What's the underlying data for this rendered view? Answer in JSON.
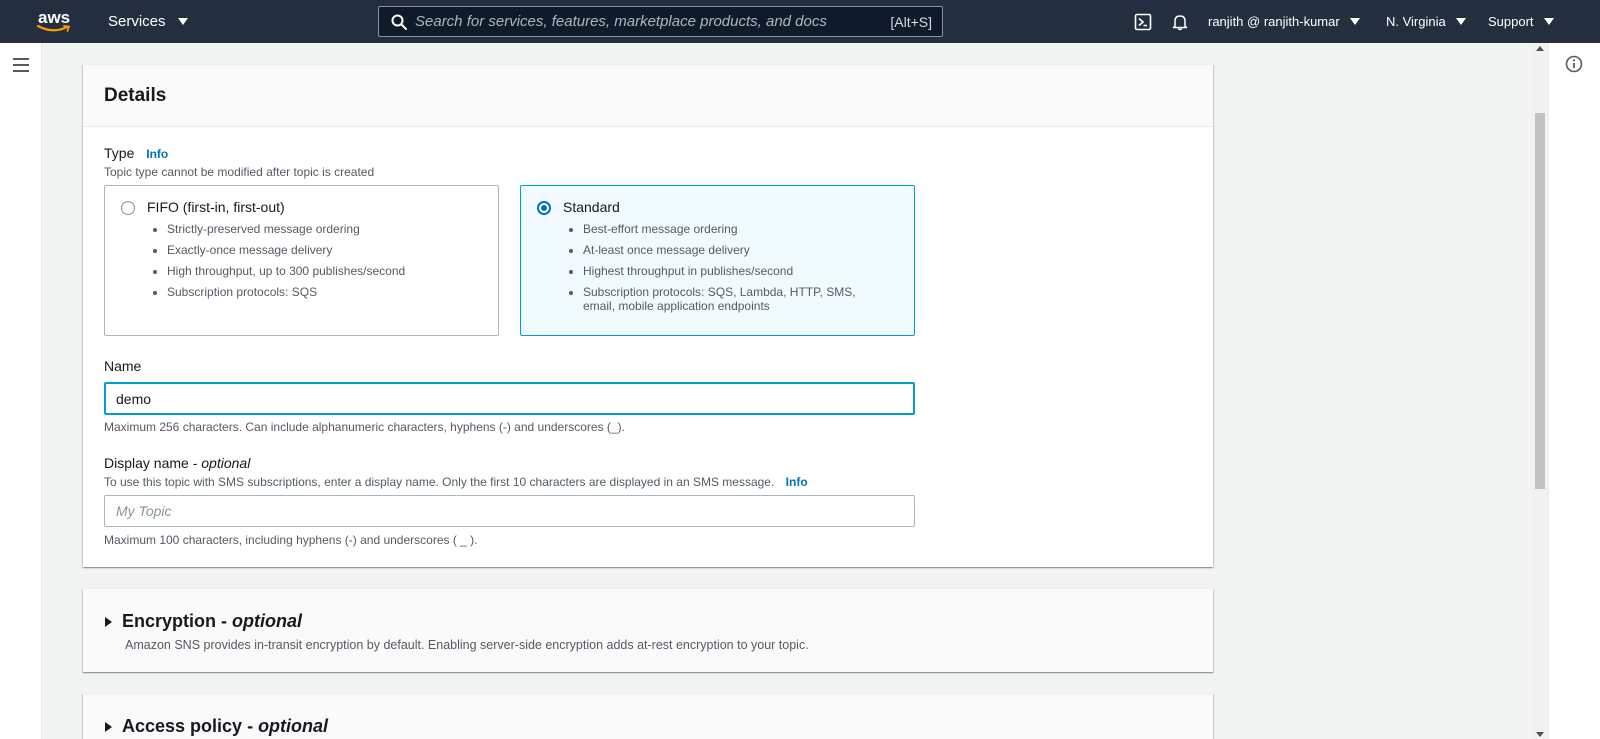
{
  "nav": {
    "logo_text": "aws",
    "services_label": "Services",
    "search_placeholder": "Search for services, features, marketplace products, and docs",
    "search_shortcut": "[Alt+S]",
    "user_label": "ranjith @ ranjith-kumar",
    "region_label": "N. Virginia",
    "support_label": "Support"
  },
  "details": {
    "title": "Details",
    "type_label": "Type",
    "type_info": "Info",
    "type_description": "Topic type cannot be modified after topic is created",
    "options": [
      {
        "title": "FIFO (first-in, first-out)",
        "selected": false,
        "bullets": [
          "Strictly-preserved message ordering",
          "Exactly-once message delivery",
          "High throughput, up to 300 publishes/second",
          "Subscription protocols: SQS"
        ]
      },
      {
        "title": "Standard",
        "selected": true,
        "bullets": [
          "Best-effort message ordering",
          "At-least once message delivery",
          "Highest throughput in publishes/second",
          "Subscription protocols: SQS, Lambda, HTTP, SMS, email, mobile application endpoints"
        ]
      }
    ],
    "name_label": "Name",
    "name_value": "demo",
    "name_constraint": "Maximum 256 characters. Can include alphanumeric characters, hyphens (-) and underscores (_).",
    "display_name_label": "Display name -",
    "display_name_optional": "optional",
    "display_name_description": "To use this topic with SMS subscriptions, enter a display name. Only the first 10 characters are displayed in an SMS message.",
    "display_name_info": "Info",
    "display_name_placeholder": "My Topic",
    "display_name_constraint": "Maximum 100 characters, including hyphens (-) and underscores ( _ )."
  },
  "encryption": {
    "title": "Encryption -",
    "optional": "optional",
    "description": "Amazon SNS provides in-transit encryption by default. Enabling server-side encryption adds at-rest encryption to your topic."
  },
  "access_policy": {
    "title": "Access policy -",
    "optional": "optional"
  },
  "colors": {
    "nav_bg": "#232f3e",
    "link": "#0073bb",
    "focus": "#00a1c9",
    "selected_tile_bg": "#f1faff",
    "aws_smile": "#ff9900"
  }
}
